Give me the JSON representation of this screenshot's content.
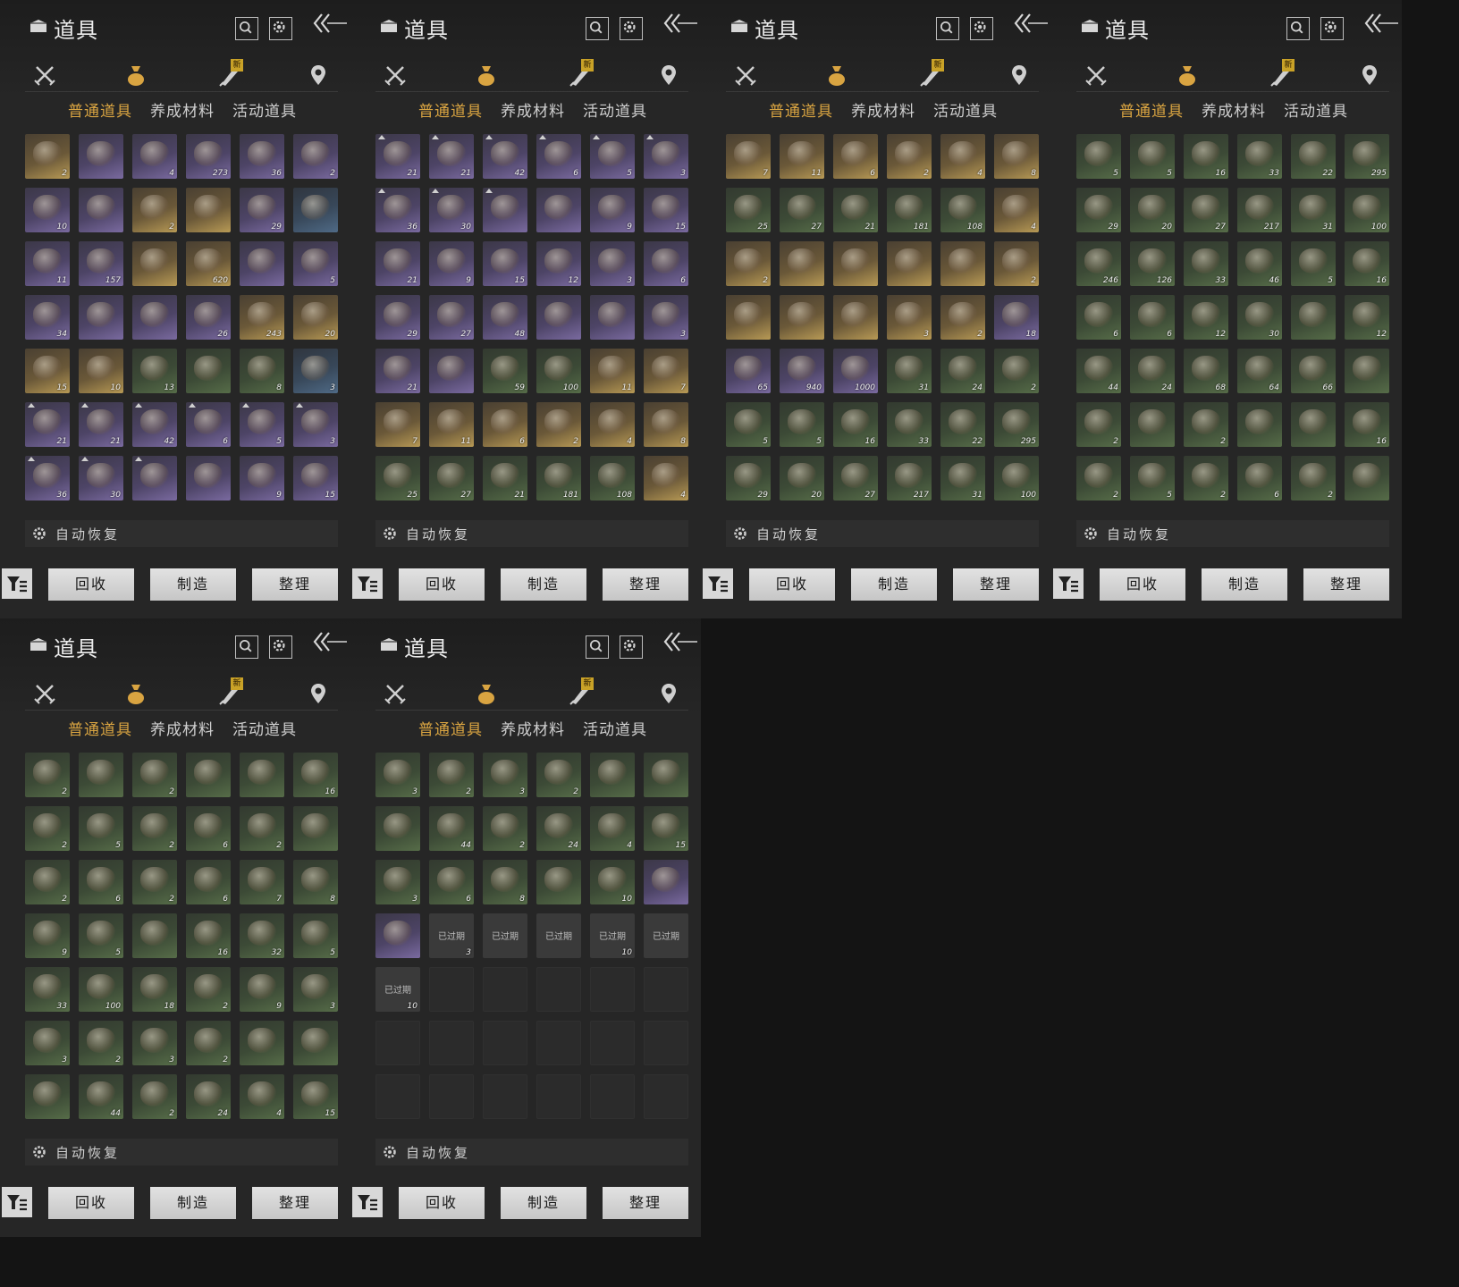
{
  "colors": {
    "active_tab": "#d9a441",
    "panel_bg": "#262626",
    "page_bg": "#141414"
  },
  "icons": {
    "bag": "item-bag-icon",
    "search": "search-icon",
    "settings": "gear-icon",
    "back": "back-arrow-icon",
    "cat_weapons": "crossed-swords-icon",
    "cat_items": "money-bag-icon",
    "cat_scroll": "scroll-brush-icon",
    "cat_location": "location-pin-icon",
    "filter": "filter-icon",
    "auto_gear": "gear-icon"
  },
  "strings": {
    "title": "道具",
    "new_badge": "新",
    "subtabs": [
      "普通道具",
      "养成材料",
      "活动道具"
    ],
    "auto_restore": "自动恢复",
    "buttons": {
      "recycle": "回收",
      "craft": "制造",
      "sort": "整理"
    },
    "expired": "已过期"
  },
  "panels": [
    {
      "items": [
        {
          "q": "gold",
          "n": "2"
        },
        {
          "q": "purple",
          "n": ""
        },
        {
          "q": "purple",
          "n": "4"
        },
        {
          "q": "purple",
          "n": "273"
        },
        {
          "q": "purple",
          "n": "36"
        },
        {
          "q": "purple",
          "n": "2"
        },
        {
          "q": "purple",
          "n": "10"
        },
        {
          "q": "purple",
          "n": ""
        },
        {
          "q": "gold",
          "n": "2"
        },
        {
          "q": "gold",
          "n": ""
        },
        {
          "q": "purple",
          "n": "29"
        },
        {
          "q": "blue",
          "n": ""
        },
        {
          "q": "purple",
          "n": "11"
        },
        {
          "q": "purple",
          "n": "157"
        },
        {
          "q": "gold",
          "n": ""
        },
        {
          "q": "gold",
          "n": "620"
        },
        {
          "q": "purple",
          "n": ""
        },
        {
          "q": "purple",
          "n": "5"
        },
        {
          "q": "purple",
          "n": "34"
        },
        {
          "q": "purple",
          "n": ""
        },
        {
          "q": "purple",
          "n": ""
        },
        {
          "q": "purple",
          "n": "26"
        },
        {
          "q": "gold",
          "n": "243"
        },
        {
          "q": "gold",
          "n": "20"
        },
        {
          "q": "gold",
          "n": "15"
        },
        {
          "q": "gold",
          "n": "10"
        },
        {
          "q": "green",
          "n": "13"
        },
        {
          "q": "green",
          "n": ""
        },
        {
          "q": "green",
          "n": "8"
        },
        {
          "q": "blue",
          "n": "3"
        },
        {
          "q": "purple",
          "n": "21",
          "up": true
        },
        {
          "q": "purple",
          "n": "21",
          "up": true
        },
        {
          "q": "purple",
          "n": "42",
          "up": true
        },
        {
          "q": "purple",
          "n": "6",
          "up": true
        },
        {
          "q": "purple",
          "n": "5",
          "up": true
        },
        {
          "q": "purple",
          "n": "3",
          "up": true
        },
        {
          "q": "purple",
          "n": "36",
          "up": true
        },
        {
          "q": "purple",
          "n": "30",
          "up": true
        },
        {
          "q": "purple",
          "n": "",
          "up": true
        },
        {
          "q": "purple",
          "n": ""
        },
        {
          "q": "purple",
          "n": "9"
        },
        {
          "q": "purple",
          "n": "15"
        }
      ]
    },
    {
      "items": [
        {
          "q": "purple",
          "n": "21",
          "up": true
        },
        {
          "q": "purple",
          "n": "21",
          "up": true
        },
        {
          "q": "purple",
          "n": "42",
          "up": true
        },
        {
          "q": "purple",
          "n": "6",
          "up": true
        },
        {
          "q": "purple",
          "n": "5",
          "up": true
        },
        {
          "q": "purple",
          "n": "3",
          "up": true
        },
        {
          "q": "purple",
          "n": "36",
          "up": true
        },
        {
          "q": "purple",
          "n": "30",
          "up": true
        },
        {
          "q": "purple",
          "n": "",
          "up": true
        },
        {
          "q": "purple",
          "n": ""
        },
        {
          "q": "purple",
          "n": "9"
        },
        {
          "q": "purple",
          "n": "15"
        },
        {
          "q": "purple",
          "n": "21"
        },
        {
          "q": "purple",
          "n": "9"
        },
        {
          "q": "purple",
          "n": "15"
        },
        {
          "q": "purple",
          "n": "12"
        },
        {
          "q": "purple",
          "n": "3"
        },
        {
          "q": "purple",
          "n": "6"
        },
        {
          "q": "purple",
          "n": "29"
        },
        {
          "q": "purple",
          "n": "27"
        },
        {
          "q": "purple",
          "n": "48"
        },
        {
          "q": "purple",
          "n": ""
        },
        {
          "q": "purple",
          "n": ""
        },
        {
          "q": "purple",
          "n": "3"
        },
        {
          "q": "purple",
          "n": "21"
        },
        {
          "q": "purple",
          "n": ""
        },
        {
          "q": "green",
          "n": "59"
        },
        {
          "q": "green",
          "n": "100"
        },
        {
          "q": "gold",
          "n": "11"
        },
        {
          "q": "gold",
          "n": "7"
        },
        {
          "q": "gold",
          "n": "7"
        },
        {
          "q": "gold",
          "n": "11"
        },
        {
          "q": "gold",
          "n": "6"
        },
        {
          "q": "gold",
          "n": "2"
        },
        {
          "q": "gold",
          "n": "4"
        },
        {
          "q": "gold",
          "n": "8"
        },
        {
          "q": "green",
          "n": "25"
        },
        {
          "q": "green",
          "n": "27"
        },
        {
          "q": "green",
          "n": "21"
        },
        {
          "q": "green",
          "n": "181"
        },
        {
          "q": "green",
          "n": "108"
        },
        {
          "q": "gold",
          "n": "4"
        }
      ]
    },
    {
      "items": [
        {
          "q": "gold",
          "n": "7"
        },
        {
          "q": "gold",
          "n": "11"
        },
        {
          "q": "gold",
          "n": "6"
        },
        {
          "q": "gold",
          "n": "2"
        },
        {
          "q": "gold",
          "n": "4"
        },
        {
          "q": "gold",
          "n": "8"
        },
        {
          "q": "green",
          "n": "25"
        },
        {
          "q": "green",
          "n": "27"
        },
        {
          "q": "green",
          "n": "21"
        },
        {
          "q": "green",
          "n": "181"
        },
        {
          "q": "green",
          "n": "108"
        },
        {
          "q": "gold",
          "n": "4"
        },
        {
          "q": "gold",
          "n": "2"
        },
        {
          "q": "gold",
          "n": ""
        },
        {
          "q": "gold",
          "n": ""
        },
        {
          "q": "gold",
          "n": ""
        },
        {
          "q": "gold",
          "n": ""
        },
        {
          "q": "gold",
          "n": "2"
        },
        {
          "q": "gold",
          "n": ""
        },
        {
          "q": "gold",
          "n": ""
        },
        {
          "q": "gold",
          "n": ""
        },
        {
          "q": "gold",
          "n": "3"
        },
        {
          "q": "gold",
          "n": "2"
        },
        {
          "q": "purple",
          "n": "18"
        },
        {
          "q": "purple",
          "n": "65"
        },
        {
          "q": "purple",
          "n": "940"
        },
        {
          "q": "purple",
          "n": "1000"
        },
        {
          "q": "green",
          "n": "31"
        },
        {
          "q": "green",
          "n": "24"
        },
        {
          "q": "green",
          "n": "2"
        },
        {
          "q": "green",
          "n": "5"
        },
        {
          "q": "green",
          "n": "5"
        },
        {
          "q": "green",
          "n": "16"
        },
        {
          "q": "green",
          "n": "33"
        },
        {
          "q": "green",
          "n": "22"
        },
        {
          "q": "green",
          "n": "295"
        },
        {
          "q": "green",
          "n": "29"
        },
        {
          "q": "green",
          "n": "20"
        },
        {
          "q": "green",
          "n": "27"
        },
        {
          "q": "green",
          "n": "217"
        },
        {
          "q": "green",
          "n": "31"
        },
        {
          "q": "green",
          "n": "100"
        }
      ]
    },
    {
      "items": [
        {
          "q": "green",
          "n": "5"
        },
        {
          "q": "green",
          "n": "5"
        },
        {
          "q": "green",
          "n": "16"
        },
        {
          "q": "green",
          "n": "33"
        },
        {
          "q": "green",
          "n": "22"
        },
        {
          "q": "green",
          "n": "295"
        },
        {
          "q": "green",
          "n": "29"
        },
        {
          "q": "green",
          "n": "20"
        },
        {
          "q": "green",
          "n": "27"
        },
        {
          "q": "green",
          "n": "217"
        },
        {
          "q": "green",
          "n": "31"
        },
        {
          "q": "green",
          "n": "100"
        },
        {
          "q": "green",
          "n": "246"
        },
        {
          "q": "green",
          "n": "126"
        },
        {
          "q": "green",
          "n": "33"
        },
        {
          "q": "green",
          "n": "46"
        },
        {
          "q": "green",
          "n": "5"
        },
        {
          "q": "green",
          "n": "16"
        },
        {
          "q": "green",
          "n": "6"
        },
        {
          "q": "green",
          "n": "6"
        },
        {
          "q": "green",
          "n": "12"
        },
        {
          "q": "green",
          "n": "30"
        },
        {
          "q": "green",
          "n": ""
        },
        {
          "q": "green",
          "n": "12"
        },
        {
          "q": "green",
          "n": "44"
        },
        {
          "q": "green",
          "n": "24"
        },
        {
          "q": "green",
          "n": "68"
        },
        {
          "q": "green",
          "n": "64"
        },
        {
          "q": "green",
          "n": "66"
        },
        {
          "q": "green",
          "n": ""
        },
        {
          "q": "green",
          "n": "2"
        },
        {
          "q": "green",
          "n": ""
        },
        {
          "q": "green",
          "n": "2"
        },
        {
          "q": "green",
          "n": ""
        },
        {
          "q": "green",
          "n": ""
        },
        {
          "q": "green",
          "n": "16"
        },
        {
          "q": "green",
          "n": "2"
        },
        {
          "q": "green",
          "n": "5"
        },
        {
          "q": "green",
          "n": "2"
        },
        {
          "q": "green",
          "n": "6"
        },
        {
          "q": "green",
          "n": "2"
        },
        {
          "q": "green",
          "n": ""
        }
      ]
    },
    {
      "items": [
        {
          "q": "green",
          "n": "2"
        },
        {
          "q": "green",
          "n": ""
        },
        {
          "q": "green",
          "n": "2"
        },
        {
          "q": "green",
          "n": ""
        },
        {
          "q": "green",
          "n": ""
        },
        {
          "q": "green",
          "n": "16"
        },
        {
          "q": "green",
          "n": "2"
        },
        {
          "q": "green",
          "n": "5"
        },
        {
          "q": "green",
          "n": "2"
        },
        {
          "q": "green",
          "n": "6"
        },
        {
          "q": "green",
          "n": "2"
        },
        {
          "q": "green",
          "n": ""
        },
        {
          "q": "green",
          "n": "2"
        },
        {
          "q": "green",
          "n": "6"
        },
        {
          "q": "green",
          "n": "2"
        },
        {
          "q": "green",
          "n": "6"
        },
        {
          "q": "green",
          "n": "7"
        },
        {
          "q": "green",
          "n": "8"
        },
        {
          "q": "green",
          "n": "9"
        },
        {
          "q": "green",
          "n": "5"
        },
        {
          "q": "green",
          "n": ""
        },
        {
          "q": "green",
          "n": "16"
        },
        {
          "q": "green",
          "n": "32"
        },
        {
          "q": "green",
          "n": "5"
        },
        {
          "q": "green",
          "n": "33"
        },
        {
          "q": "green",
          "n": "100"
        },
        {
          "q": "green",
          "n": "18"
        },
        {
          "q": "green",
          "n": "2"
        },
        {
          "q": "green",
          "n": "9"
        },
        {
          "q": "green",
          "n": "3"
        },
        {
          "q": "green",
          "n": "3"
        },
        {
          "q": "green",
          "n": "2"
        },
        {
          "q": "green",
          "n": "3"
        },
        {
          "q": "green",
          "n": "2"
        },
        {
          "q": "green",
          "n": ""
        },
        {
          "q": "green",
          "n": ""
        },
        {
          "q": "green",
          "n": ""
        },
        {
          "q": "green",
          "n": "44"
        },
        {
          "q": "green",
          "n": "2"
        },
        {
          "q": "green",
          "n": "24"
        },
        {
          "q": "green",
          "n": "4"
        },
        {
          "q": "green",
          "n": "15"
        }
      ]
    },
    {
      "items": [
        {
          "q": "green",
          "n": "3"
        },
        {
          "q": "green",
          "n": "2"
        },
        {
          "q": "green",
          "n": "3"
        },
        {
          "q": "green",
          "n": "2"
        },
        {
          "q": "green",
          "n": ""
        },
        {
          "q": "green",
          "n": ""
        },
        {
          "q": "green",
          "n": ""
        },
        {
          "q": "green",
          "n": "44"
        },
        {
          "q": "green",
          "n": "2"
        },
        {
          "q": "green",
          "n": "24"
        },
        {
          "q": "green",
          "n": "4"
        },
        {
          "q": "green",
          "n": "15"
        },
        {
          "q": "green",
          "n": "3"
        },
        {
          "q": "green",
          "n": "6"
        },
        {
          "q": "green",
          "n": "8"
        },
        {
          "q": "green",
          "n": ""
        },
        {
          "q": "green",
          "n": "10"
        },
        {
          "q": "purple",
          "n": ""
        },
        {
          "q": "purple",
          "n": ""
        },
        {
          "q": "expired",
          "n": "3"
        },
        {
          "q": "expired",
          "n": ""
        },
        {
          "q": "expired",
          "n": ""
        },
        {
          "q": "expired",
          "n": "10"
        },
        {
          "q": "expired",
          "n": ""
        },
        {
          "q": "expired",
          "n": "10"
        },
        {
          "q": "empty",
          "n": ""
        },
        {
          "q": "empty",
          "n": ""
        },
        {
          "q": "empty",
          "n": ""
        },
        {
          "q": "empty",
          "n": ""
        },
        {
          "q": "empty",
          "n": ""
        },
        {
          "q": "empty",
          "n": ""
        },
        {
          "q": "empty",
          "n": ""
        },
        {
          "q": "empty",
          "n": ""
        },
        {
          "q": "empty",
          "n": ""
        },
        {
          "q": "empty",
          "n": ""
        },
        {
          "q": "empty",
          "n": ""
        },
        {
          "q": "empty",
          "n": ""
        },
        {
          "q": "empty",
          "n": ""
        },
        {
          "q": "empty",
          "n": ""
        },
        {
          "q": "empty",
          "n": ""
        },
        {
          "q": "empty",
          "n": ""
        },
        {
          "q": "empty",
          "n": ""
        }
      ]
    }
  ]
}
